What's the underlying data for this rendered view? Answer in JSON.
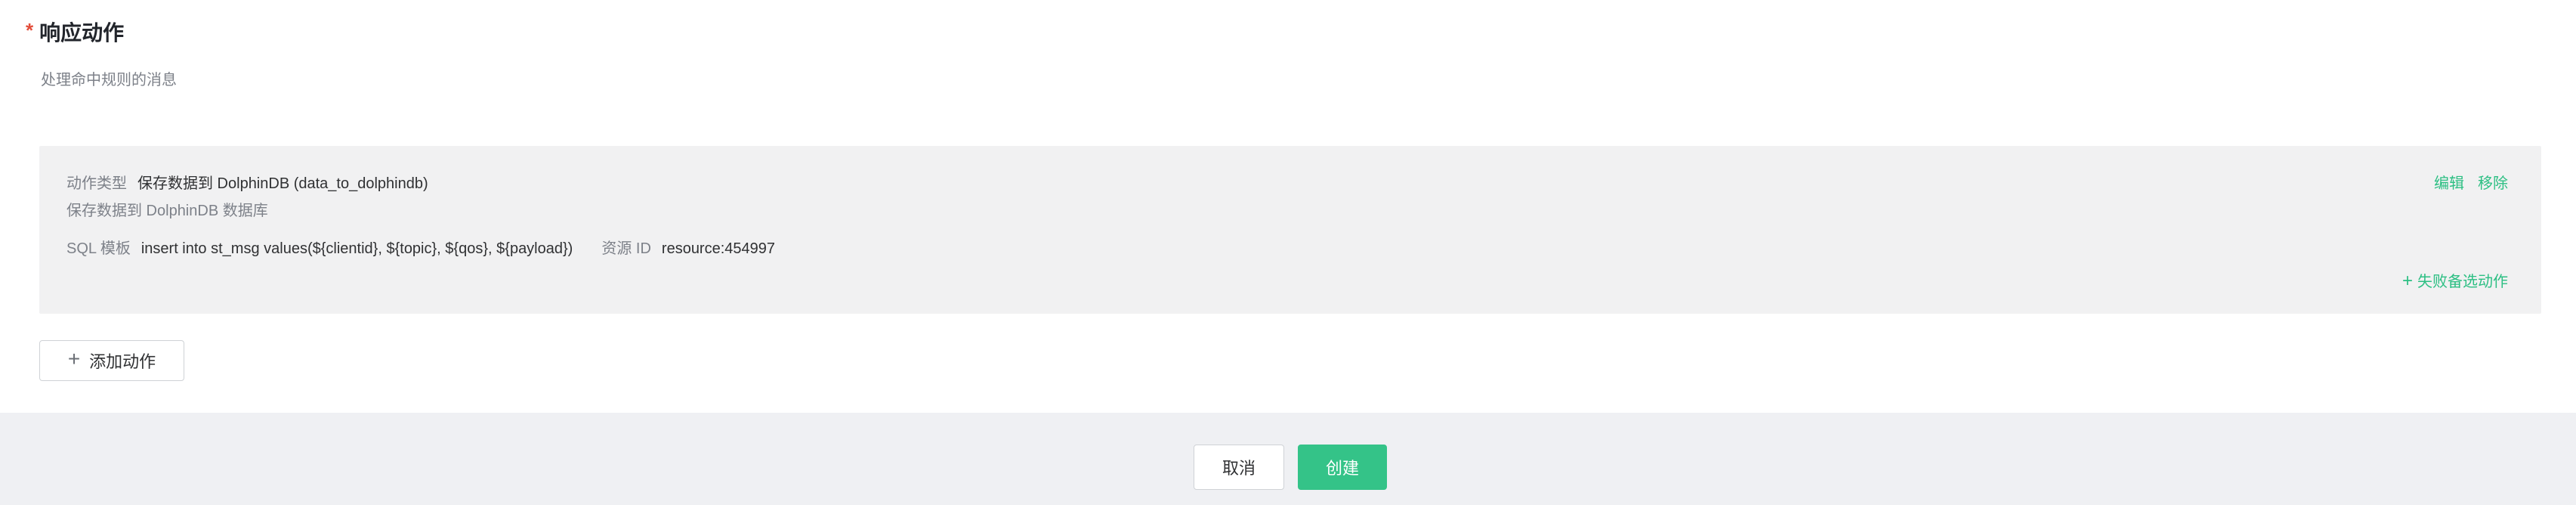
{
  "section": {
    "required_mark": "*",
    "title": "响应动作",
    "description": "处理命中规则的消息"
  },
  "action": {
    "type_label": "动作类型",
    "type_value": "保存数据到 DolphinDB (data_to_dolphindb)",
    "description": "保存数据到 DolphinDB 数据库",
    "sql_label": "SQL 模板",
    "sql_value": "insert into st_msg values(${clientid}, ${topic}, ${qos}, ${payload})",
    "resource_label": "资源 ID",
    "resource_value": "resource:454997",
    "edit_label": "编辑",
    "remove_label": "移除",
    "fallback_label": "失败备选动作"
  },
  "add_action_label": "添加动作",
  "footer": {
    "cancel_label": "取消",
    "create_label": "创建"
  },
  "colors": {
    "accent": "#2cbf83",
    "primary_button": "#34c388",
    "required": "#e34d3a",
    "card_bg": "#f1f1f2",
    "footer_bg": "#eff0f3"
  },
  "icons": {
    "plus": "plus-icon"
  }
}
